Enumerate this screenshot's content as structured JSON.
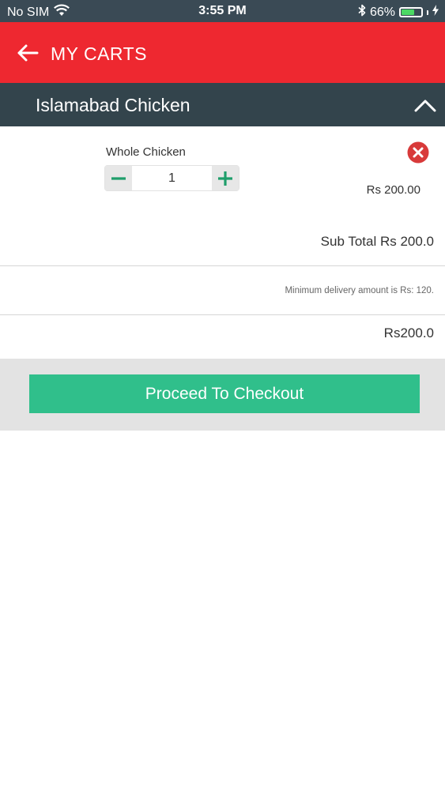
{
  "status_bar": {
    "carrier": "No SIM",
    "time": "3:55 PM",
    "battery_percent": "66%",
    "battery_level": 0.66
  },
  "header": {
    "title": "MY CARTS"
  },
  "restaurant": {
    "name": "Islamabad Chicken"
  },
  "cart_items": [
    {
      "name": "Whole Chicken",
      "quantity": "1",
      "price": "Rs 200.00"
    }
  ],
  "subtotal": "Sub Total Rs  200.0",
  "min_delivery_note": "Minimum delivery amount is Rs: 120.",
  "total": "Rs200.0",
  "checkout": {
    "label": "Proceed To Checkout"
  },
  "colors": {
    "header_red": "#ee2830",
    "section_dark": "#33444c",
    "checkout_green": "#30bf8b",
    "remove_red": "#d83a3a"
  }
}
